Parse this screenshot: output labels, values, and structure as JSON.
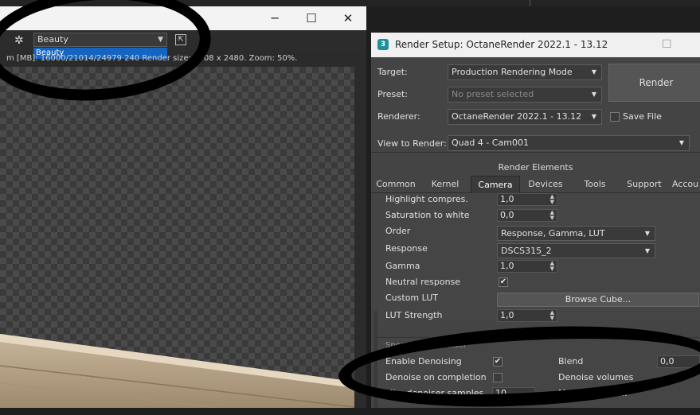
{
  "frame_buffer": {
    "window_controls": {
      "minimize": "─",
      "maximize": "☐",
      "close": "✕"
    },
    "channel_dropdown": {
      "value": "Beauty",
      "option": "Beauty"
    },
    "info_bar": "m [MB]: 16000/21014/24979 240   Render size: 3508 x 2480.   Zoom: 50%."
  },
  "render_setup": {
    "title": "Render Setup: OctaneRender 2022.1 - 13.12",
    "logo_text": "3",
    "target": {
      "label": "Target:",
      "value": "Production Rendering Mode"
    },
    "preset": {
      "label": "Preset:",
      "value": "No preset selected"
    },
    "renderer": {
      "label": "Renderer:",
      "value": "OctaneRender 2022.1 - 13.12"
    },
    "save_file_label": "Save File",
    "view": {
      "label": "View to Render:",
      "value": "Quad 4 - Cam001"
    },
    "render_button": "Render",
    "render_elements": "Render Elements",
    "tabs": [
      "Common",
      "Kernel",
      "Camera",
      "Devices",
      "Tools",
      "Support",
      "Accou"
    ],
    "active_tab": "Camera",
    "camera": {
      "highlight": {
        "label": "Highlight compres.",
        "value": "1,0"
      },
      "saturation": {
        "label": "Saturation to white",
        "value": "0,0"
      },
      "order": {
        "label": "Order",
        "value": "Response, Gamma, LUT"
      },
      "response": {
        "label": "Response",
        "value": "DSCS315_2"
      },
      "gamma": {
        "label": "Gamma",
        "value": "1,0"
      },
      "neutral": {
        "label": "Neutral response",
        "checked": true
      },
      "custom_lut": {
        "label": "Custom LUT",
        "button": "Browse Cube..."
      },
      "lut_strength": {
        "label": "LUT Strength",
        "value": "1,0"
      }
    },
    "denoiser": {
      "group_title": "Spectral AI Denoiser",
      "enable": {
        "label": "Enable Denoising",
        "checked": true
      },
      "on_completion": {
        "label": "Denoise on completion",
        "checked": false
      },
      "blend": {
        "label": "Blend",
        "value": "0,0"
      },
      "volumes": {
        "label": "Denoise volumes"
      },
      "samples": {
        "label": "Min. denoiser samples",
        "value": "10"
      },
      "max_label": "Max. denoiser..."
    }
  }
}
